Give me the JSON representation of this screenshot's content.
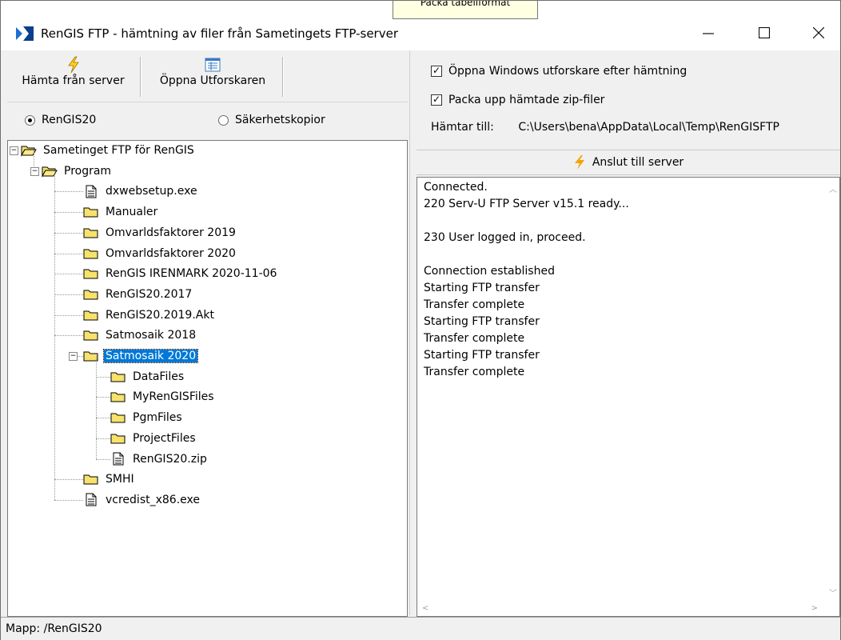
{
  "window": {
    "title": "RenGIS FTP - hämtning av filer från Sametingets FTP-server",
    "tooltip_fragment": "Packa tabellformat"
  },
  "toolbar": {
    "fetch_label": "Hämta från server",
    "explorer_label": "Öppna Utforskaren"
  },
  "source": {
    "option_rengis": "RenGIS20",
    "option_backup": "Säkerhetskopior",
    "selected": "RenGIS20"
  },
  "tree": {
    "root": "Sametinget FTP för RenGIS",
    "program": "Program",
    "items": [
      "dxwebsetup.exe",
      "Manualer",
      "Omvarldsfaktorer 2019",
      "Omvarldsfaktorer 2020",
      "RenGIS IRENMARK 2020-11-06",
      "RenGIS20.2017",
      "RenGIS20.2019.Akt",
      "Satmosaik 2018",
      "Satmosaik 2020"
    ],
    "sat2020_children": [
      "DataFiles",
      "MyRenGISFiles",
      "PgmFiles",
      "ProjectFiles",
      "RenGIS20.zip"
    ],
    "after": [
      "SMHI",
      "vcredist_x86.exe"
    ],
    "selected": "Satmosaik 2020"
  },
  "options": {
    "open_explorer_label": "Öppna Windows utforskare efter hämtning",
    "open_explorer_checked": true,
    "unzip_label": "Packa upp hämtade zip-filer",
    "unzip_checked": true,
    "dest_label": "Hämtar till:",
    "dest_path": "C:\\Users\\bena\\AppData\\Local\\Temp\\RenGISFTP"
  },
  "connect": {
    "label": "Anslut till server"
  },
  "log": {
    "lines": [
      "Connected.",
      "220 Serv-U FTP Server v15.1 ready...",
      "",
      "230 User logged in, proceed.",
      "",
      "Connection established",
      "Starting FTP transfer",
      "Transfer complete",
      "Starting FTP transfer",
      "Transfer complete",
      "Starting FTP transfer",
      "Transfer complete"
    ]
  },
  "status": {
    "text": "Mapp: /RenGIS20"
  },
  "colors": {
    "selection": "#0078d7",
    "folder": "#f7e26b",
    "bolt": "#f5a300"
  }
}
